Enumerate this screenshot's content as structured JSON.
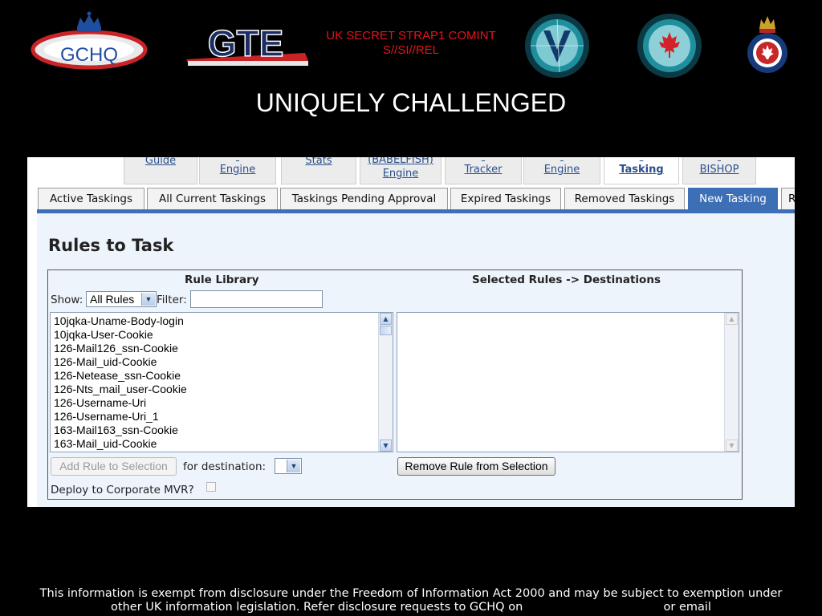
{
  "header": {
    "logos": {
      "gchq_text": "GCHQ",
      "gte_text": "GTE"
    },
    "classification": {
      "line1": "UK SECRET STRAP1 COMINT",
      "line2": "S//SI//REL"
    },
    "title": "UNIQUELY CHALLENGED",
    "colors": {
      "classification": "#e8121a",
      "background": "#000000"
    }
  },
  "top_tabs": [
    {
      "line1": "Guide",
      "line2": ""
    },
    {
      "line1": "",
      "line2": "Engine"
    },
    {
      "line1": "Stats",
      "line2": ""
    },
    {
      "line1": "(BABELFISH)",
      "line2": "Engine"
    },
    {
      "line1": "",
      "line2": "Tracker"
    },
    {
      "line1": "",
      "line2": "Engine"
    },
    {
      "line1": "",
      "line2": "Tasking"
    },
    {
      "line1": "",
      "line2": "BISHOP"
    }
  ],
  "sub_tabs": [
    {
      "label": "Active Taskings"
    },
    {
      "label": "All Current Taskings"
    },
    {
      "label": "Taskings Pending Approval"
    },
    {
      "label": "Expired Taskings"
    },
    {
      "label": "Removed Taskings"
    },
    {
      "label": "New Tasking",
      "active": true
    },
    {
      "label": "R"
    }
  ],
  "rules": {
    "heading": "Rules to Task",
    "library_header": "Rule Library",
    "selected_header": "Selected Rules -> Destinations",
    "show_label": "Show:",
    "show_value": "All Rules",
    "filter_label": "Filter:",
    "filter_value": "",
    "library_items": [
      "10jqka-Uname-Body-login",
      "10jqka-User-Cookie",
      "126-Mail126_ssn-Cookie",
      "126-Mail_uid-Cookie",
      "126-Netease_ssn-Cookie",
      "126-Nts_mail_user-Cookie",
      "126-Username-Uri",
      "126-Username-Uri_1",
      "163-Mail163_ssn-Cookie",
      "163-Mail_uid-Cookie"
    ],
    "add_button": "Add Rule to Selection",
    "destination_label": "for destination:",
    "destination_value": "",
    "remove_button": "Remove Rule from Selection",
    "deploy_label": "Deploy to Corporate MVR?",
    "deploy_checked": false,
    "accent_color": "#3d6fb6"
  },
  "footer": {
    "line1": "This information is exempt from disclosure under the Freedom of Information Act 2000 and may be subject to exemption under",
    "line2a": "other UK information legislation. Refer disclosure requests to GCHQ on",
    "line2b": "or email"
  }
}
